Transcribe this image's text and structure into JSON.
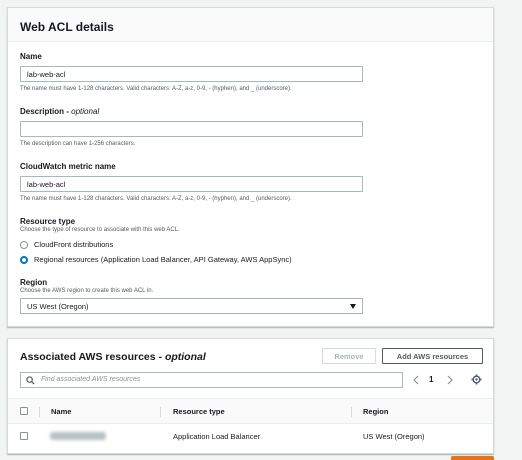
{
  "acl_panel": {
    "title": "Web ACL details",
    "name": {
      "label": "Name",
      "value": "lab-web-acl",
      "hint": "The name must have 1-128 characters. Valid characters: A-Z, a-z, 0-9, - (hyphen), and _ (underscore)."
    },
    "description": {
      "label": "Description",
      "optional": "optional",
      "value": "",
      "hint": "The description can have 1-256 characters."
    },
    "metric": {
      "label": "CloudWatch metric name",
      "value": "lab-web-acl",
      "hint": "The name must have 1-128 characters. Valid characters: A-Z, a-z, 0-9, - (hyphen), and _ (underscore)."
    },
    "resource_type": {
      "label": "Resource type",
      "hint": "Choose the type of resource to associate with this web ACL.",
      "options": [
        {
          "label": "CloudFront distributions",
          "selected": false
        },
        {
          "label": "Regional resources (Application Load Balancer, API Gateway, AWS AppSync)",
          "selected": true
        }
      ]
    },
    "region": {
      "label": "Region",
      "hint": "Choose the AWS region to create this web ACL in.",
      "selected": "US West (Oregon)"
    }
  },
  "resources_panel": {
    "title": "Associated AWS resources",
    "optional": "optional",
    "remove_label": "Remove",
    "add_label": "Add AWS resources",
    "search_placeholder": "Find associated AWS resources",
    "page": "1",
    "columns": [
      "Name",
      "Resource type",
      "Region"
    ],
    "rows": [
      {
        "name": "",
        "resource_type": "Application Load Balancer",
        "region": "US West (Oregon)"
      }
    ]
  },
  "colors": {
    "accent": "#0073bb",
    "primary_button": "#ec7211",
    "border": "#aab7b8"
  }
}
